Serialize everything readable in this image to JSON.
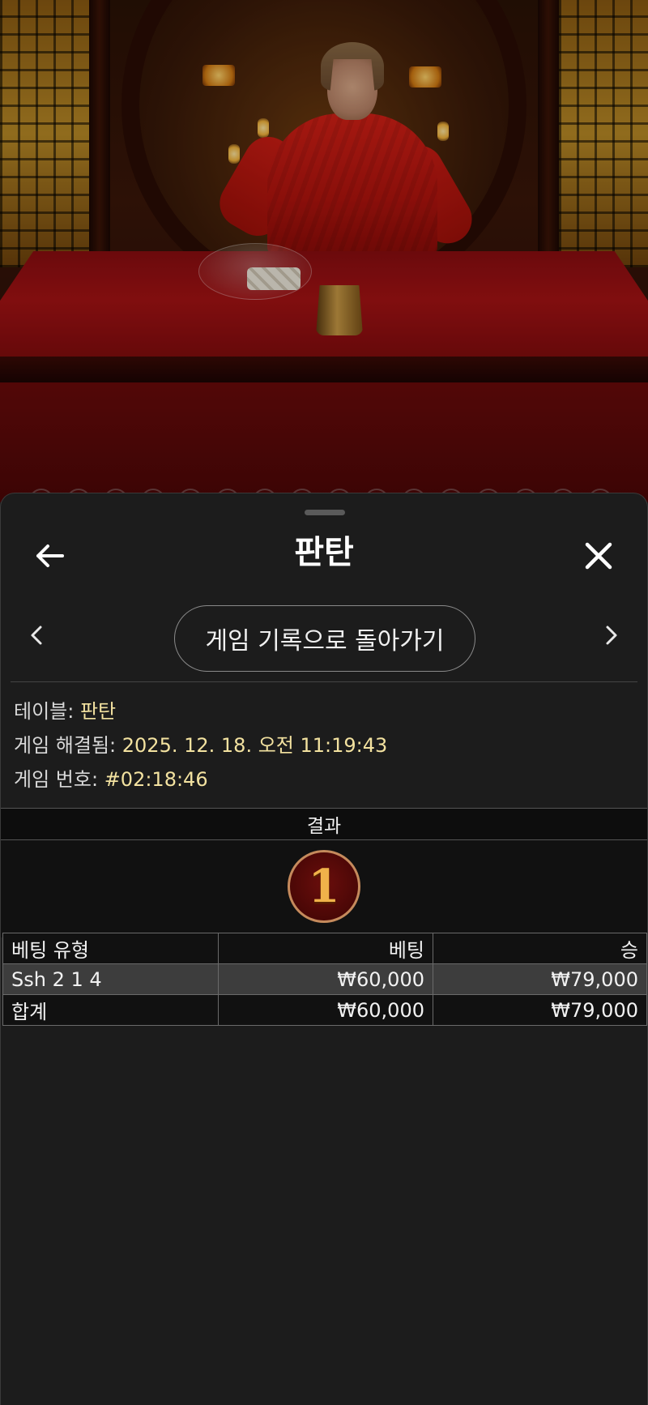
{
  "header": {
    "title": "판탄"
  },
  "navigation": {
    "back_to_history_label": "게임 기록으로 돌아가기"
  },
  "details": {
    "table_label": "테이블:",
    "table_value": "판탄",
    "resolved_label": "게임 해결됨:",
    "resolved_value": "2025. 12. 18. 오전 11:19:43",
    "game_no_label": "게임 번호:",
    "game_no_value": "#02:18:46"
  },
  "result": {
    "heading": "결과",
    "value": "1"
  },
  "bets_table": {
    "headers": [
      "베팅 유형",
      "베팅",
      "승"
    ],
    "rows": [
      {
        "type": "Ssh 2 1 4",
        "bet": "₩60,000",
        "win": "₩79,000"
      },
      {
        "type": "합계",
        "bet": "₩60,000",
        "win": "₩79,000"
      }
    ]
  },
  "colors": {
    "sheet_bg": "#1c1c1c",
    "value_text": "#f3e2a0",
    "result_coin_gold": "#f0b24a",
    "result_coin_red": "#6a0e0c"
  },
  "icons": {
    "back": "arrow-left-icon",
    "close": "close-icon",
    "prev": "chevron-left-icon",
    "next": "chevron-right-icon"
  }
}
